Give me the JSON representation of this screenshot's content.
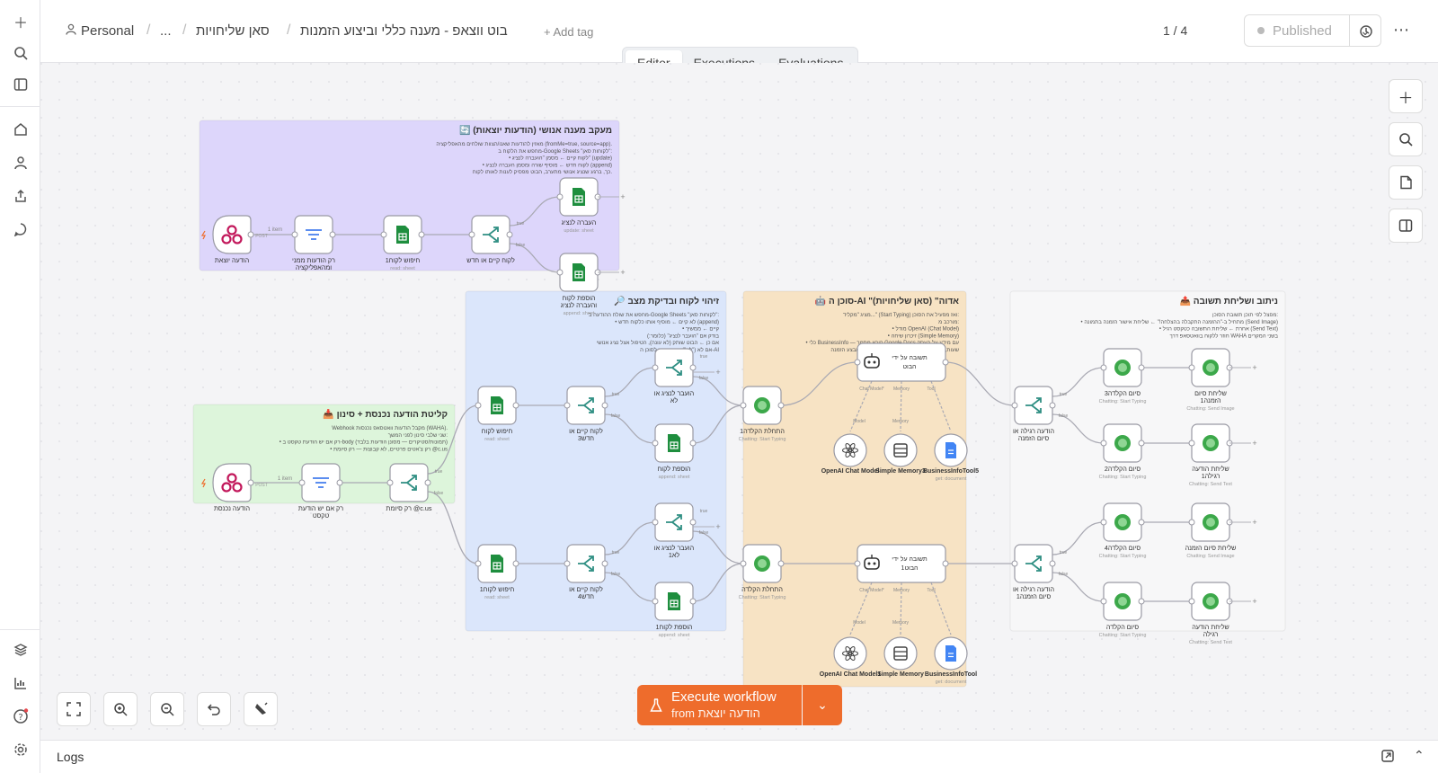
{
  "breadcrumb": {
    "project": "Personal",
    "ellipsis": "...",
    "folder": "סאן שליחויות",
    "workflow_name": "בוט ווצאפ - מענה כללי וביצוע הזמנות",
    "add_tag": "+ Add tag"
  },
  "header": {
    "version_counter": "1 / 4",
    "published_label": "Published"
  },
  "tabs": [
    {
      "label": "Editor"
    },
    {
      "label": "Executions"
    },
    {
      "label": "Evaluations"
    }
  ],
  "execute": {
    "label": "Execute workflow",
    "sub_label": "from הודעה יוצאת"
  },
  "logs": {
    "label": "Logs"
  },
  "colors": {
    "accent": "#ee6c2c",
    "sticky_purple": "#ddd6fb",
    "sticky_blue": "#dbe6fb",
    "sticky_green": "#ddf5db",
    "sticky_orange": "#f7e3c4",
    "sheets_green": "#1e8e3e"
  },
  "stickies": [
    {
      "title": "🔄 מעקב מענה אנושי (הודעות יוצאות)",
      "lines": [
        "מאזין להודעות שאנו/הצוות שולחים מהאפליקציה (fromMe=true, source=app).",
        "מחפש את הלקוח ב-Google Sheets \"לקוחות סאן\":",
        "• לקוח קיים ← מסמן \"הועברה לנציג\" (update)",
        "• לקוח חדש ← מוסיף שורה ומסמן העברה לנציג (append)",
        "כך, ברגע שנציג אנושי מתערב, הבוט מפסיק לענות לאותו לקוח."
      ]
    },
    {
      "title": "📥 קליטת הודעה נכנסת + סינון",
      "lines": [
        "Webhook מקבל הודעות וואטסאפ נכנסות (WAHA).",
        "שני שלבי סינון לפני המשך:",
        "• רק אם יש הודעת טקסט ב-body (תמונות/סטיקרים — מסונן הודעות בלבד)",
        "• רק צ'אטים פרטיים, לא קבוצות — רק סיומת @c.us"
      ]
    },
    {
      "title": "🔎 זיהוי לקוח ובדיקת מצב",
      "lines": [
        "מחפש את שולח ההודעה ב-Google Sheets \"לקוחות סאן\":",
        "• לא קיים ← מוסיף אותו כלקוח חדש (append)",
        "• קיים ← ממשיך",
        "בודק אם \"הועבר לנציג\" (כלומר:)",
        "אם כן ← הבוט שותק (לא עונה), הטיפול אצל נציג אנושי",
        "אם לא (\"לא\") ← ממשיך לסוכן ה-AI"
      ]
    },
    {
      "title": "🤖 סוכן ה-AI \"אדוה\" (סאן שליחויות)",
      "lines": [
        "מציג \"מקליד...\" (Start Typing) ואז מפעיל את הסוכן:",
        "מורכב מ:",
        "• מודל OpenAI (Chat Model)",
        "• זיכרון שיחה (Simple Memory)",
        "• כלי BusinessInfo — קורא מסמך Google Docs עם מידע על העסק",
        "שעות, מחירים, אזורי חלוקה ועוד, נותן מחיר ומבצע הזמנה"
      ]
    },
    {
      "title": "📤 ניתוב ושליחת תשובה",
      "lines": [
        "מפצל לפי תוכן תשובת הסוכן:",
        "• מתחיל ב-\"ההזמנה התקבלה בהצלחה!\" ← שליחת אישור הזמנה בתמונה (Send Image)",
        "• אחרת ← שליחת התשובה כטקסט רגיל (Send Text)",
        "חוזר ללקוח בוואטסאפ דרך WAHA בשני המקרים"
      ]
    }
  ],
  "nodes": [
    {
      "title": "הודעה יוצאת",
      "sub": ""
    },
    {
      "title": "רק הודעות ממני ומהאפליקציה",
      "sub": ""
    },
    {
      "title": "חיפוש לקוח1",
      "sub": "read: sheet"
    },
    {
      "title": "לקוח קיים או חדש",
      "sub": ""
    },
    {
      "title": "העברה לנציג",
      "sub": "update: sheet"
    },
    {
      "title": "הוספת לקוח והעברה לנציג",
      "sub": "append: sheet"
    },
    {
      "title": "הודעה נכנסת",
      "sub": ""
    },
    {
      "title": "רק אם יש הודעת טקסט",
      "sub": ""
    },
    {
      "title": "רק סיומת @c.us",
      "sub": ""
    },
    {
      "title": "חיפוש לקוח",
      "sub": "read: sheet"
    },
    {
      "title": "לקוח קיים או חדש3",
      "sub": ""
    },
    {
      "title": "הועבר לנציג או לא",
      "sub": ""
    },
    {
      "title": "הוספת לקוח",
      "sub": "append: sheet"
    },
    {
      "title": "חיפוש לקוח1",
      "sub": "read: sheet"
    },
    {
      "title": "לקוח קיים או חדש4",
      "sub": ""
    },
    {
      "title": "הועבר לנציג או לא1",
      "sub": ""
    },
    {
      "title": "הוספת לקוח1",
      "sub": "append: sheet"
    },
    {
      "title": "התחלת הקלדה1",
      "sub": "Chatting: Start Typing"
    },
    {
      "title": "תשובה על ידי הבוט",
      "sub": ""
    },
    {
      "title": "OpenAI Chat Model",
      "sub": ""
    },
    {
      "title": "Simple Memory3",
      "sub": ""
    },
    {
      "title": "BusinessInfoTool5",
      "sub": "get: document"
    },
    {
      "title": "התחלת הקלדה",
      "sub": "Chatting: Start Typing"
    },
    {
      "title": "תשובה על ידי הבוט1",
      "sub": ""
    },
    {
      "title": "OpenAI Chat Model1",
      "sub": ""
    },
    {
      "title": "Simple Memory",
      "sub": ""
    },
    {
      "title": "BusinessInfoTool",
      "sub": "get: document"
    },
    {
      "title": "הודעה רגילה או סיום הזמנה",
      "sub": ""
    },
    {
      "title": "סיום הקלדה3",
      "sub": "Chatting: Start Typing"
    },
    {
      "title": "שליחת סיום הזמנה1",
      "sub": "Chatting: Send Image"
    },
    {
      "title": "סיום הקלדה2",
      "sub": "Chatting: Start Typing"
    },
    {
      "title": "שליחת הודעה רגילה1",
      "sub": "Chatting: Send Text"
    },
    {
      "title": "הודעה רגילה או סיום הזמנה1",
      "sub": ""
    },
    {
      "title": "סיום הקלדה4",
      "sub": "Chatting: Start Typing"
    },
    {
      "title": "שליחת סיום הזמנה",
      "sub": "Chatting: Send Image"
    },
    {
      "title": "סיום הקלדה",
      "sub": "Chatting: Start Typing"
    },
    {
      "title": "שליחת הודעה רגילה",
      "sub": "Chatting: Send Text"
    }
  ],
  "edge_labels": {
    "item": "1 item",
    "post": "POST",
    "true": "true",
    "false": "false",
    "model": "Model",
    "memory": "Memory",
    "tool": "Tool",
    "chat_model": "Chat Model*"
  }
}
